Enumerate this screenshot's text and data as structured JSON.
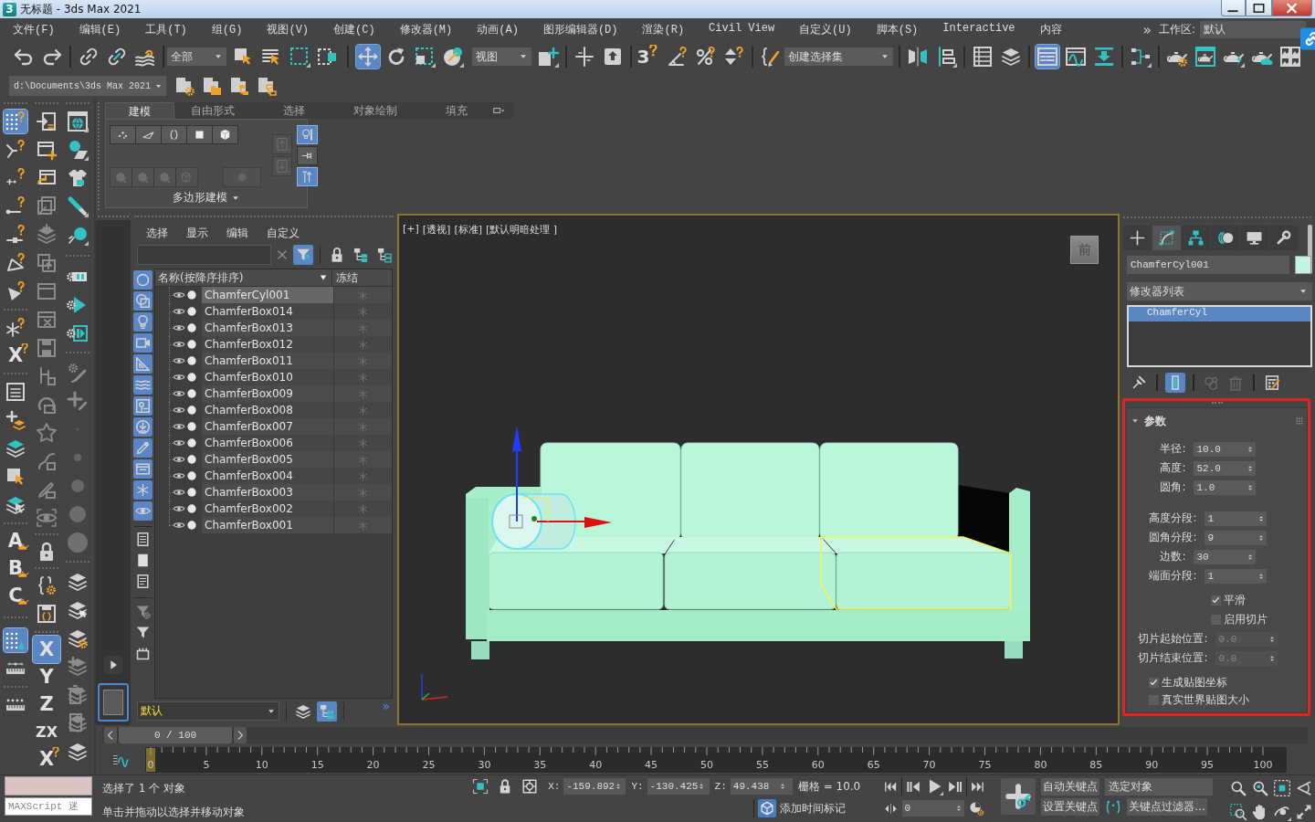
{
  "window": {
    "logo": "3",
    "title": "无标题 - 3ds Max 2021"
  },
  "menu_bar": {
    "items": [
      "文件(F)",
      "编辑(E)",
      "工具(T)",
      "组(G)",
      "视图(V)",
      "创建(C)",
      "修改器(M)",
      "动画(A)",
      "图形编辑器(D)",
      "渲染(R)",
      "Civil View",
      "自定义(U)",
      "脚本(S)",
      "Interactive",
      "内容"
    ],
    "overflow": "»",
    "workspace_label": "工作区:",
    "workspace": "默认"
  },
  "main_toolbar": {
    "selection_filter": "全部",
    "reference_coordinate": "视图",
    "named_selection": "创建选择集",
    "tools": [
      {
        "selected": false
      },
      {
        "selected": false
      },
      {
        "selected": false
      },
      {
        "selected": false
      },
      {
        "selected": false
      },
      {
        "selected": false
      },
      {
        "selected": false
      },
      {
        "selected": false
      },
      {
        "selected": false
      },
      {
        "selected": true
      },
      {
        "selected": false
      },
      {
        "selected": false
      },
      {
        "selected": false
      },
      {
        "selected": false
      },
      {
        "selected": false
      },
      {
        "selected": false
      },
      {
        "glyph": "3",
        "selected": false
      },
      {
        "selected": false
      },
      {
        "selected": false
      },
      {
        "selected": false
      },
      {
        "selected": false
      },
      {
        "selected": false
      },
      {
        "selected": false
      },
      {
        "selected": false
      },
      {
        "selected": false
      },
      {
        "selected": true
      },
      {
        "selected": false
      },
      {
        "selected": false
      },
      {
        "selected": false
      },
      {
        "selected": false
      },
      {
        "selected": false
      },
      {
        "selected": false
      },
      {
        "selected": false
      },
      {
        "selected": false
      }
    ]
  },
  "project_bar": {
    "path": "d:\\Documents\\3ds Max 2021"
  },
  "ribbon": {
    "tabs": [
      {
        "label": "建模",
        "selected": true
      },
      {
        "label": "自由形式",
        "selected": false
      },
      {
        "label": "选择",
        "selected": false
      },
      {
        "label": "对象绘制",
        "selected": false
      },
      {
        "label": "填充",
        "selected": false
      }
    ],
    "tools": [
      {
        "selected": false,
        "disabled": false
      },
      {
        "selected": false,
        "disabled": false
      },
      {
        "selected": false,
        "disabled": false
      },
      {
        "selected": false,
        "disabled": false
      },
      {
        "selected": false,
        "disabled": false
      },
      {
        "selected": false,
        "disabled": true
      },
      {
        "selected": false,
        "disabled": true
      },
      {
        "selected": false,
        "disabled": true
      },
      {
        "selected": false,
        "disabled": true
      },
      {
        "selected": false,
        "disabled": true
      },
      {
        "selected": false,
        "disabled": true
      },
      {
        "selected": false,
        "disabled": true
      },
      {
        "selected": true,
        "disabled": false
      },
      {
        "selected": false,
        "disabled": false
      },
      {
        "selected": true,
        "disabled": false
      }
    ],
    "panel_title": "多边形建模"
  },
  "command_toolbar": {
    "columns": [
      [
        {
          "selected": true
        },
        {
          "selected": false
        },
        {
          "selected": false
        },
        {
          "selected": false
        },
        {
          "selected": false
        },
        {
          "selected": false
        },
        {
          "selected": false
        },
        {
          "selected": false
        },
        {
          "glyph": "X",
          "selected": false
        },
        {
          "selected": false
        },
        {
          "selected": false
        },
        {
          "selected": false
        },
        {
          "selected": false
        },
        {
          "selected": false
        },
        {
          "glyph": "A",
          "selected": false
        },
        {
          "glyph": "B",
          "selected": false
        },
        {
          "glyph": "C",
          "selected": false
        },
        {
          "selected": true
        },
        {
          "selected": false
        },
        {
          "selected": false
        }
      ],
      [
        {
          "selected": false
        },
        {
          "selected": false
        },
        {
          "selected": false
        },
        {
          "selected": false
        },
        {
          "selected": false
        },
        {
          "selected": false
        },
        {
          "selected": false
        },
        {
          "selected": false
        },
        {
          "selected": false
        },
        {
          "selected": false
        },
        {
          "selected": false
        },
        {
          "selected": false
        },
        {
          "selected": false
        },
        {
          "selected": false
        },
        {
          "selected": false
        },
        {
          "selected": false
        },
        {
          "selected": false
        },
        {
          "selected": false
        },
        {
          "glyph": "X",
          "selected": true
        },
        {
          "glyph": "Y",
          "selected": false
        },
        {
          "glyph": "Z",
          "selected": false
        },
        {
          "glyph": "ZX",
          "selected": false
        },
        {
          "glyph": "X",
          "selected": false
        }
      ],
      [
        {
          "selected": false
        },
        {
          "selected": false
        },
        {
          "selected": false
        },
        {
          "selected": false
        },
        {
          "selected": false
        },
        {
          "selected": false
        },
        {
          "selected": false
        },
        {
          "selected": false
        },
        {
          "selected": false
        },
        {
          "selected": false
        },
        {
          "selected": false
        },
        {
          "selected": false
        },
        {
          "selected": false
        },
        {
          "selected": false
        },
        {
          "selected": false
        },
        {
          "selected": false
        },
        {
          "selected": false
        },
        {
          "selected": false
        },
        {
          "selected": false
        },
        {
          "selected": false
        },
        {
          "selected": false
        },
        {
          "selected": false
        }
      ]
    ]
  },
  "scene_explorer": {
    "menus": [
      "选择",
      "显示",
      "编辑",
      "自定义"
    ],
    "toolbar": [
      {
        "selected": true
      },
      {
        "selected": false
      },
      {
        "selected": false
      },
      {
        "selected": false
      }
    ],
    "filters": [
      {
        "selected": true
      },
      {
        "selected": true
      },
      {
        "selected": true
      },
      {
        "selected": true
      },
      {
        "selected": true
      },
      {
        "selected": true
      },
      {
        "selected": true
      },
      {
        "selected": true
      },
      {
        "selected": true
      },
      {
        "selected": true
      },
      {
        "selected": true
      },
      {
        "selected": true
      },
      {
        "selected": false
      },
      {
        "selected": false
      },
      {
        "selected": false
      },
      {
        "selected": false
      },
      {
        "selected": false
      },
      {
        "selected": false
      }
    ],
    "columns": [
      "名称(按降序排序)",
      "冻结"
    ],
    "rows": [
      {
        "name": "ChamferCyl001",
        "selected": true,
        "visible": true,
        "frozen": false
      },
      {
        "name": "ChamferBox014",
        "selected": false,
        "visible": true,
        "frozen": false
      },
      {
        "name": "ChamferBox013",
        "selected": false,
        "visible": true,
        "frozen": false
      },
      {
        "name": "ChamferBox012",
        "selected": false,
        "visible": true,
        "frozen": false
      },
      {
        "name": "ChamferBox011",
        "selected": false,
        "visible": true,
        "frozen": false
      },
      {
        "name": "ChamferBox010",
        "selected": false,
        "visible": true,
        "frozen": false
      },
      {
        "name": "ChamferBox009",
        "selected": false,
        "visible": true,
        "frozen": false
      },
      {
        "name": "ChamferBox008",
        "selected": false,
        "visible": true,
        "frozen": false
      },
      {
        "name": "ChamferBox007",
        "selected": false,
        "visible": true,
        "frozen": false
      },
      {
        "name": "ChamferBox006",
        "selected": false,
        "visible": true,
        "frozen": false
      },
      {
        "name": "ChamferBox005",
        "selected": false,
        "visible": true,
        "frozen": false
      },
      {
        "name": "ChamferBox004",
        "selected": false,
        "visible": true,
        "frozen": false
      },
      {
        "name": "ChamferBox003",
        "selected": false,
        "visible": true,
        "frozen": false
      },
      {
        "name": "ChamferBox002",
        "selected": false,
        "visible": true,
        "frozen": false
      },
      {
        "name": "ChamferBox001",
        "selected": false,
        "visible": true,
        "frozen": false
      }
    ],
    "layer": "默认",
    "layer_tools": [
      {
        "selected": false
      },
      {
        "selected": true
      }
    ],
    "more": "»"
  },
  "viewport": {
    "active": true,
    "labels": [
      "[+]",
      "[透视]",
      "[标准]",
      "[默认明暗处理 ]"
    ],
    "viewcube": "前"
  },
  "command_panel": {
    "tabs": [
      {
        "selected": false
      },
      {
        "selected": true
      },
      {
        "selected": false
      },
      {
        "selected": false
      },
      {
        "selected": false
      },
      {
        "selected": false
      }
    ],
    "object_name": "ChamferCyl001",
    "color": "#c4f3e1",
    "modifier_list": "修改器列表",
    "stack": [
      {
        "label": "ChamferCyl",
        "selected": true
      }
    ],
    "stack_tools": [
      {
        "selected": false,
        "disabled": false
      },
      {
        "selected": true,
        "disabled": false
      },
      {
        "selected": false,
        "disabled": true
      },
      {
        "selected": false,
        "disabled": true
      },
      {
        "selected": false,
        "disabled": false
      }
    ],
    "rollout": {
      "title": "参数",
      "expanded": true,
      "highlighted": true,
      "groups": [
        [
          {
            "kind": "spinner",
            "label": "半径:",
            "value": "10.0",
            "disabled": false
          },
          {
            "kind": "spinner",
            "label": "高度:",
            "value": "52.0",
            "disabled": false
          },
          {
            "kind": "spinner",
            "label": "圆角:",
            "value": "1.0",
            "disabled": false
          }
        ],
        [
          {
            "kind": "spinner",
            "label": "高度分段:",
            "value": "1",
            "disabled": false
          },
          {
            "kind": "spinner",
            "label": "圆角分段:",
            "value": "9",
            "disabled": false
          },
          {
            "kind": "spinner",
            "label": "边数:",
            "value": "30",
            "disabled": false
          },
          {
            "kind": "spinner",
            "label": "端面分段:",
            "value": "1",
            "disabled": false
          }
        ],
        [
          {
            "kind": "checkbox",
            "label": "平滑",
            "checked": true
          },
          {
            "kind": "checkbox",
            "label": "启用切片",
            "checked": false
          },
          {
            "kind": "spinner",
            "label": "切片起始位置:",
            "value": "0.0",
            "disabled": true
          },
          {
            "kind": "spinner",
            "label": "切片结束位置:",
            "value": "0.0",
            "disabled": true
          }
        ],
        [
          {
            "kind": "checkbox",
            "label": "生成贴图坐标",
            "checked": true
          },
          {
            "kind": "checkbox",
            "label": "真实世界贴图大小",
            "checked": false
          }
        ]
      ]
    }
  },
  "time_slider": {
    "label": "0 / 100",
    "level": 0
  },
  "track_bar": {
    "frames": [
      "0",
      "5",
      "10",
      "15",
      "20",
      "25",
      "30",
      "35",
      "40",
      "45",
      "50",
      "55",
      "60",
      "65",
      "70",
      "75",
      "80",
      "85",
      "90",
      "95",
      "100"
    ]
  },
  "status_bar": {
    "maxscript_placeholder": "MAXScript 迷",
    "prompt": "选择了 1 个 对象",
    "hint": "单击并拖动以选择并移动对象",
    "coordinates": [
      {
        "axis": "X:",
        "value": "-159.892"
      },
      {
        "axis": "Y:",
        "value": "-130.425"
      },
      {
        "axis": "Z:",
        "value": "49.438"
      }
    ],
    "grid": "栅格 = 10.0",
    "add_time_tag": "添加时间标记",
    "frame": "0",
    "auto_key": {
      "label": "自动关键点",
      "on": false
    },
    "key_target": "选定对象",
    "set_key": "设置关键点",
    "key_filters": "关键点过滤器..."
  }
}
